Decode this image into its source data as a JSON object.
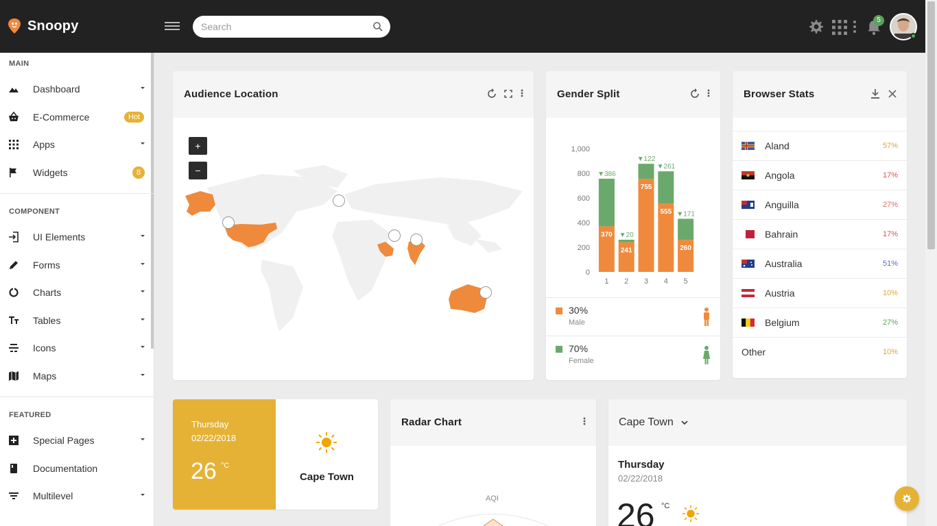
{
  "app": {
    "name": "Snoopy"
  },
  "search": {
    "placeholder": "Search"
  },
  "notifications": {
    "count": "5"
  },
  "sidebar": {
    "sections": [
      {
        "title": "MAIN"
      },
      {
        "title": "COMPONENT"
      },
      {
        "title": "FEATURED"
      }
    ],
    "items": [
      {
        "label": "Dashboard",
        "icon": "dashboard-icon"
      },
      {
        "label": "E-Commerce",
        "icon": "basket-icon",
        "badge": "Hot"
      },
      {
        "label": "Apps",
        "icon": "apps-icon"
      },
      {
        "label": "Widgets",
        "icon": "flag-icon",
        "badge": "8"
      },
      {
        "label": "UI Elements",
        "icon": "login-icon"
      },
      {
        "label": "Forms",
        "icon": "pencil-icon"
      },
      {
        "label": "Charts",
        "icon": "donut-chart-icon"
      },
      {
        "label": "Tables",
        "icon": "text-size-icon"
      },
      {
        "label": "Icons",
        "icon": "icons-icon"
      },
      {
        "label": "Maps",
        "icon": "map-icon"
      },
      {
        "label": "Special Pages",
        "icon": "special-pages-icon"
      },
      {
        "label": "Documentation",
        "icon": "book-icon"
      },
      {
        "label": "Multilevel",
        "icon": "filter-icon"
      }
    ]
  },
  "audience": {
    "title": "Audience Location",
    "zoom_in": "+",
    "zoom_out": "−",
    "highlighted_regions": [
      "Alaska",
      "United States",
      "Saudi Arabia",
      "India",
      "Australia"
    ]
  },
  "gender": {
    "title": "Gender Split",
    "male": {
      "pct": "30%",
      "label": "Male"
    },
    "female": {
      "pct": "70%",
      "label": "Female"
    }
  },
  "browser": {
    "title": "Browser Stats",
    "rows": [
      {
        "country": "Aland",
        "pct": "57%",
        "color": "#e5a136"
      },
      {
        "country": "Angola",
        "pct": "17%",
        "color": "#d9534f"
      },
      {
        "country": "Anguilla",
        "pct": "27%",
        "color": "#e06a6a"
      },
      {
        "country": "Bahrain",
        "pct": "17%",
        "color": "#d9534f"
      },
      {
        "country": "Australia",
        "pct": "51%",
        "color": "#5b6bc0"
      },
      {
        "country": "Austria",
        "pct": "10%",
        "color": "#e5a136"
      },
      {
        "country": "Belgium",
        "pct": "27%",
        "color": "#5aa25b"
      },
      {
        "country": "Other",
        "pct": "10%",
        "color": "#e5a136"
      }
    ]
  },
  "weather_card": {
    "day": "Thursday",
    "date": "02/22/2018",
    "temp": "26",
    "unit": "°C",
    "city": "Cape Town"
  },
  "radar": {
    "title": "Radar Chart",
    "axis_label": "AQI"
  },
  "weather_detail": {
    "city": "Cape Town",
    "day": "Thursday",
    "date": "02/22/2018",
    "temp": "26",
    "unit": "°C"
  },
  "colors": {
    "accent": "#e5b236",
    "orange": "#ef8a3c",
    "green": "#6aa96b",
    "topbar": "#222222"
  },
  "chart_data": {
    "type": "bar",
    "stacked": true,
    "categories": [
      "1",
      "2",
      "3",
      "4",
      "5"
    ],
    "series": [
      {
        "name": "Male",
        "color": "#ef8a3c",
        "values": [
          370,
          241,
          755,
          555,
          260
        ]
      },
      {
        "name": "Female",
        "color": "#6aa96b",
        "values": [
          386,
          20,
          122,
          261,
          171
        ]
      }
    ],
    "female_labels": [
      "▼386",
      "▼20",
      "▼122",
      "▼261",
      "▼171"
    ],
    "yticks": [
      "0",
      "200",
      "400",
      "600",
      "800",
      "1,000"
    ],
    "ylim": [
      0,
      1000
    ]
  }
}
